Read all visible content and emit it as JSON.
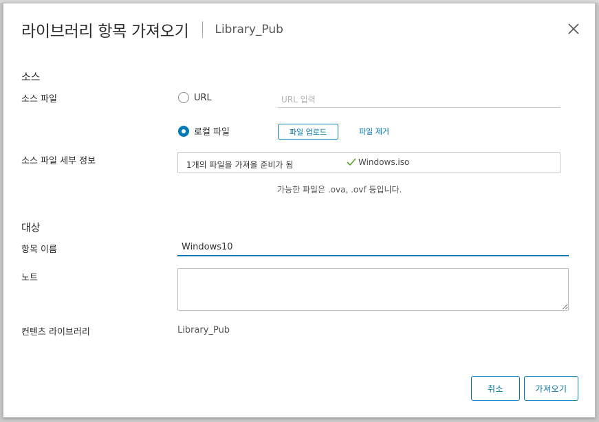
{
  "dialog": {
    "title": "라이브러리 항목 가져오기",
    "subtitle": "Library_Pub",
    "close_icon": "close-icon"
  },
  "source": {
    "heading": "소스",
    "file_label": "소스 파일",
    "url_option": "URL",
    "url_selected": false,
    "url_placeholder": "URL 입력",
    "url_value": "",
    "local_option": "로컬 파일",
    "local_selected": true,
    "upload_button": "파일 업로드",
    "remove_link": "파일 제거",
    "details_label": "소스 파일 세부 정보",
    "details_status": "1개의 파일을 가져올 준비가 됨",
    "details_file": "Windows.iso",
    "details_file_icon": "checkmark-icon",
    "hint": "가능한 파일은 .ova, .ovf 등입니다."
  },
  "target": {
    "heading": "대상",
    "name_label": "항목 이름",
    "name_value": "Windows10",
    "notes_label": "노트",
    "notes_value": "",
    "library_label": "컨텐츠 라이브러리",
    "library_value": "Library_Pub"
  },
  "footer": {
    "cancel_button": "취소",
    "import_button": "가져오기"
  },
  "colors": {
    "accent": "#0079b8",
    "link": "#0072a3",
    "check": "#5aa220"
  }
}
